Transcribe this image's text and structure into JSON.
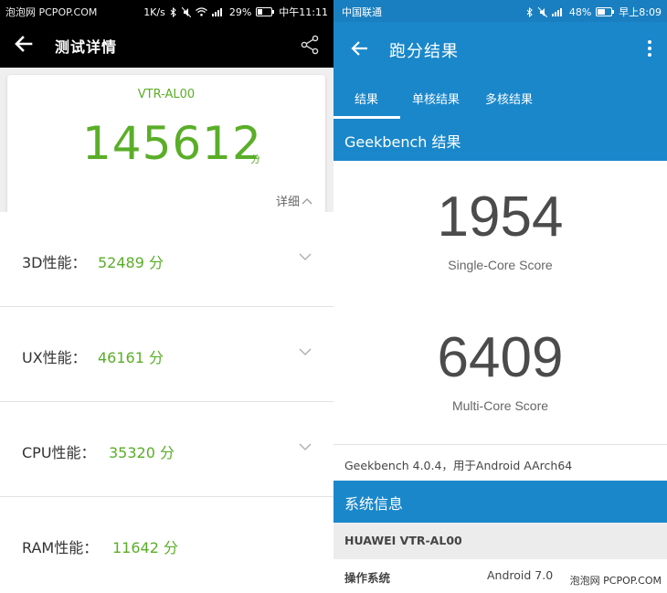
{
  "left": {
    "status_bar": {
      "watermark": "泡泡网 PCPOP.COM",
      "carrier": "泡泡网 PCPOP.COM",
      "speed": "1K/s",
      "battery": "29%",
      "time": "中午11:11"
    },
    "app_bar": {
      "title": "测试详情"
    },
    "summary": {
      "device": "VTR-AL00",
      "total_score": "145612",
      "unit": "分",
      "detail_label": "详细"
    },
    "categories": [
      {
        "label": "3D性能：",
        "value": "52489 分"
      },
      {
        "label": "UX性能：",
        "value": "46161 分"
      },
      {
        "label": "CPU性能：",
        "value": "35320 分"
      },
      {
        "label": "RAM性能：",
        "value": "11642 分"
      }
    ],
    "colors": {
      "accent": "#5aae28",
      "bar": "#000000"
    }
  },
  "right": {
    "status_bar": {
      "carrier": "中国联通",
      "battery": "48%",
      "time": "早上8:09"
    },
    "app_bar": {
      "title": "跑分结果"
    },
    "tabs": [
      {
        "label": "结果",
        "active": true
      },
      {
        "label": "单核结果",
        "active": false
      },
      {
        "label": "多核结果",
        "active": false
      }
    ],
    "geekbench_header": "Geekbench 结果",
    "single_core": {
      "score": "1954",
      "caption": "Single-Core Score"
    },
    "multi_core": {
      "score": "6409",
      "caption": "Multi-Core Score"
    },
    "version_text": "Geekbench 4.0.4，用于Android AArch64",
    "system_header": "系统信息",
    "model": "HUAWEI VTR-AL00",
    "os_row": {
      "key": "操作系统",
      "value": "Android 7.0"
    },
    "watermark": "泡泡网 PCPOP.COM",
    "colors": {
      "primary": "#1a87cb"
    }
  }
}
